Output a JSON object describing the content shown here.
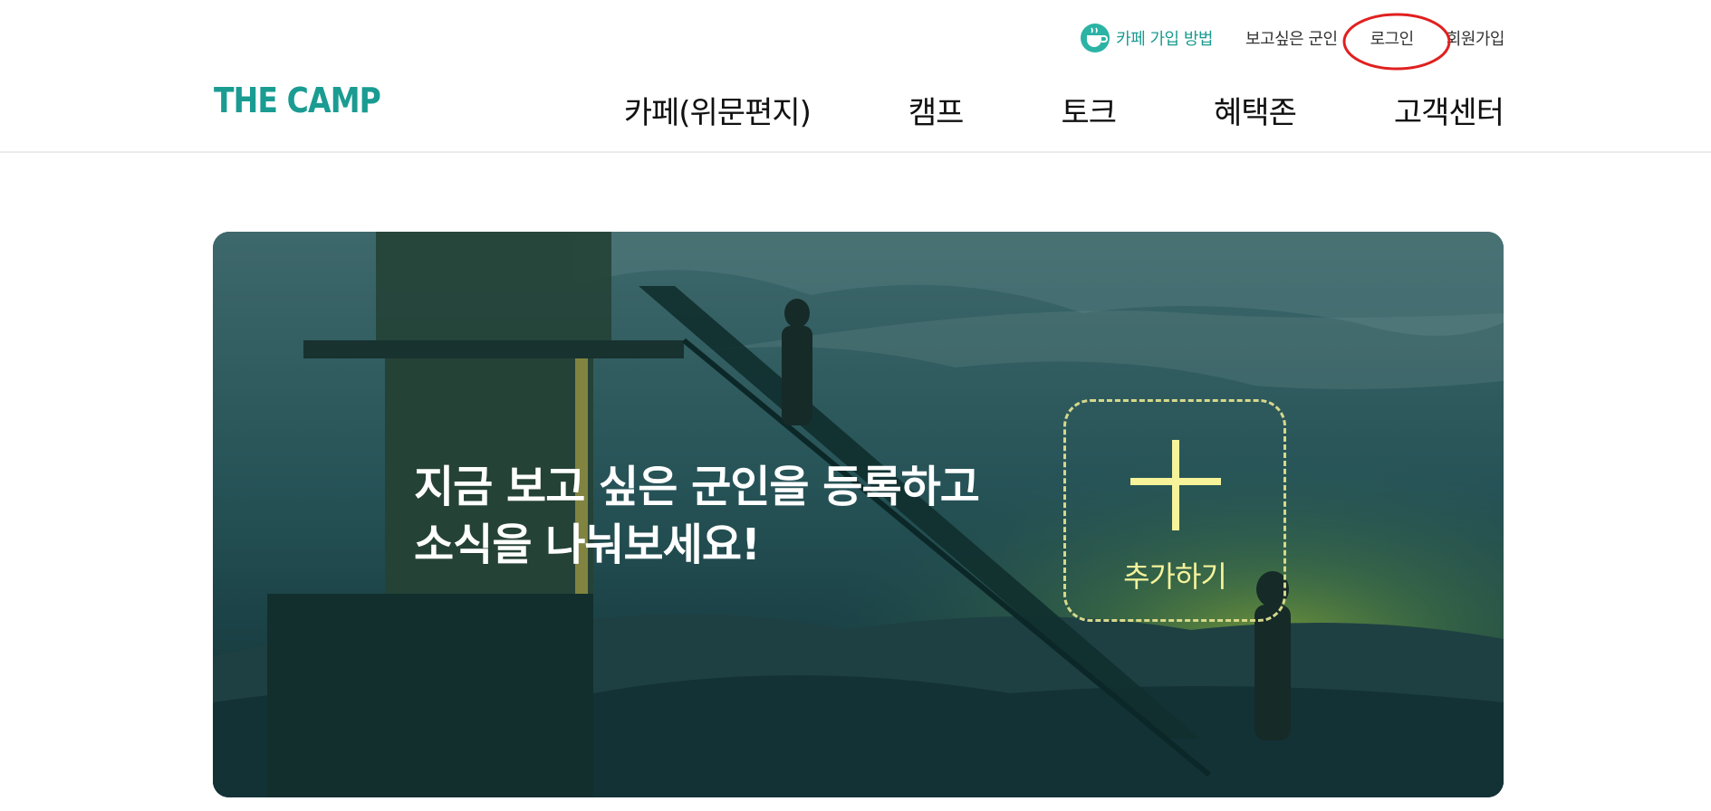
{
  "util_nav": {
    "cafe_guide": "카페 가입 방법",
    "soldier_to_see": "보고싶은 군인",
    "login": "로그인",
    "signup": "회원가입",
    "accent_color": "#199b8f",
    "highlight_color": "#e0201f"
  },
  "logo": {
    "text": "THE CAMP"
  },
  "main_nav": {
    "items": [
      "카페(위문편지)",
      "캠프",
      "토크",
      "혜택존",
      "고객센터"
    ]
  },
  "hero": {
    "headline_line1": "지금 보고 싶은 군인을 등록하고",
    "headline_line2": "소식을 나눠보세요!",
    "add_label": "추가하기",
    "add_accent_color": "#f6f39a"
  }
}
